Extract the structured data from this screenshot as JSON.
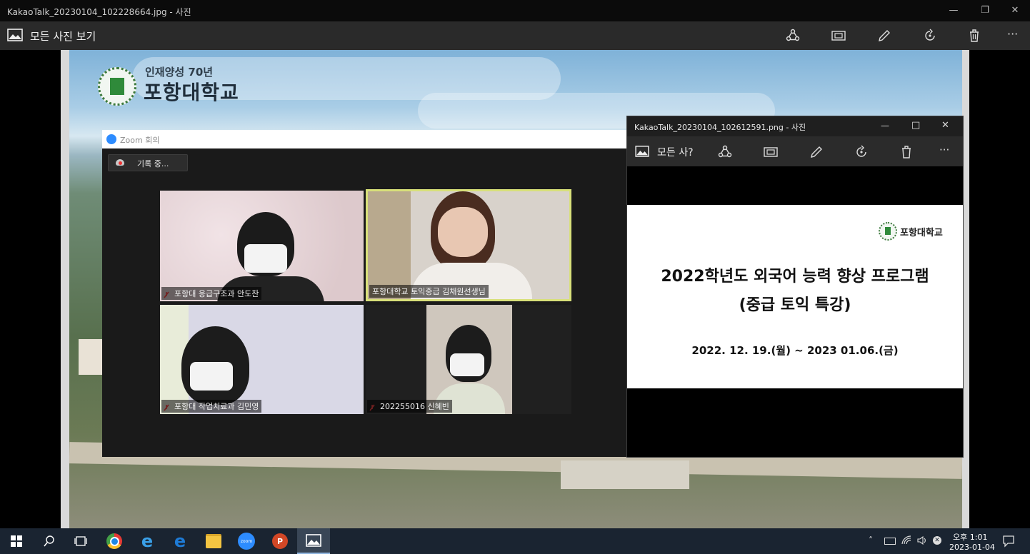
{
  "main_window": {
    "title": "KakaoTalk_20230104_102228664.jpg - 사진",
    "view_all_label": "모든 사진 보기",
    "toolbar_icons": [
      "share-icon",
      "slideshow-icon",
      "edit-icon",
      "rotate-icon",
      "delete-icon",
      "more-icon"
    ],
    "more_label": "···"
  },
  "background_photo": {
    "logo_line1": "인재양성 70년",
    "logo_line2": "포항대학교"
  },
  "zoom": {
    "window_title": "Zoom 회의",
    "recording_label": "기록 중...",
    "participants": [
      {
        "name": "포항대 응급구조과 안도찬",
        "muted": true,
        "active_speaker": false
      },
      {
        "name": "포항대학교 토익중급 김채원선생님",
        "muted": false,
        "active_speaker": true
      },
      {
        "name": "포항대 작업치료과 김민영",
        "muted": true,
        "active_speaker": false
      },
      {
        "name": "202255016 신혜빈",
        "muted": true,
        "active_speaker": false
      }
    ],
    "active_speaker_color": "#d8e07a"
  },
  "second_window": {
    "title": "KakaoTalk_20230104_102612591.png - 사진",
    "view_all_label": "모든 사?",
    "more_label": "···",
    "slide": {
      "brand": "포항대학교",
      "title_line1": "2022학년도 외국어 능력 향상 프로그램",
      "title_line2": "(중급 토익 특강)",
      "period": "2022. 12. 19.(월) ~ 2023 01.06.(금)"
    }
  },
  "taskbar": {
    "apps": [
      "start-icon",
      "search-icon",
      "task-view-icon",
      "chrome-icon",
      "ie-icon",
      "edge-icon",
      "file-explorer-icon",
      "zoom-icon",
      "powerpoint-icon",
      "photos-icon"
    ],
    "zoom_app_label": "zoom",
    "clock_time": "오후 1:01",
    "clock_date": "2023-01-04"
  },
  "colors": {
    "accent": "#2d8cff",
    "taskbar": "#1a2431",
    "titlebar": "#0b0b0b"
  }
}
